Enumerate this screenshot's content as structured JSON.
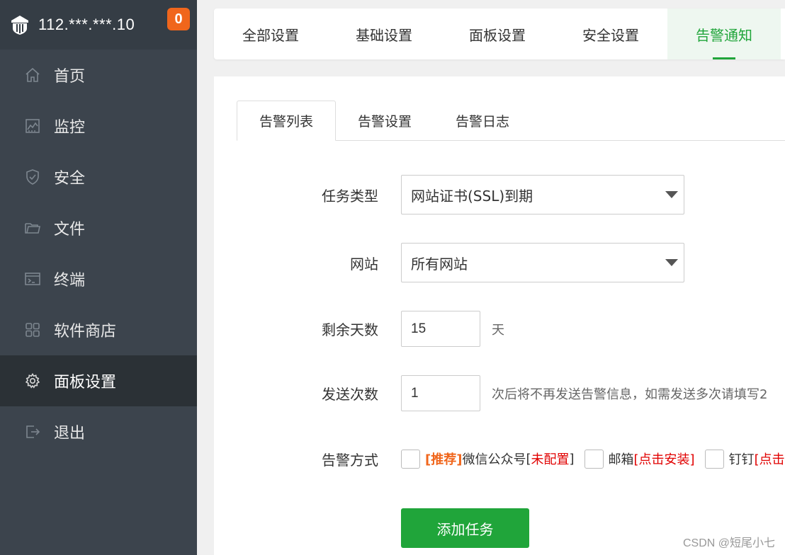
{
  "sidebar": {
    "server_name": "112.***.***.10",
    "badge_count": "0",
    "items": [
      {
        "label": "首页",
        "icon": "home-icon"
      },
      {
        "label": "监控",
        "icon": "monitor-icon"
      },
      {
        "label": "安全",
        "icon": "shield-icon"
      },
      {
        "label": "文件",
        "icon": "folder-icon"
      },
      {
        "label": "终端",
        "icon": "terminal-icon"
      },
      {
        "label": "软件商店",
        "icon": "apps-icon"
      },
      {
        "label": "面板设置",
        "icon": "gear-icon",
        "active": true
      },
      {
        "label": "退出",
        "icon": "logout-icon"
      }
    ]
  },
  "top_tabs": [
    {
      "label": "全部设置"
    },
    {
      "label": "基础设置"
    },
    {
      "label": "面板设置"
    },
    {
      "label": "安全设置"
    },
    {
      "label": "告警通知",
      "active": true
    }
  ],
  "sub_tabs": [
    {
      "label": "告警列表",
      "active": true
    },
    {
      "label": "告警设置"
    },
    {
      "label": "告警日志"
    }
  ],
  "form": {
    "task_type": {
      "label": "任务类型",
      "value": "网站证书(SSL)到期"
    },
    "site": {
      "label": "网站",
      "value": "所有网站"
    },
    "days_left": {
      "label": "剩余天数",
      "value": "15",
      "unit": "天"
    },
    "send_count": {
      "label": "发送次数",
      "value": "1",
      "hint": "次后将不再发送告警信息，如需发送多次请填写2"
    },
    "methods": {
      "label": "告警方式",
      "wechat": {
        "recommend": "[推荐]",
        "name": "微信公众号",
        "status_open": "[",
        "status": "未配置",
        "status_close": "]"
      },
      "email": {
        "name": "邮箱",
        "status": "[点击安装]"
      },
      "dingtalk": {
        "name": "钉钉",
        "status": "[点击"
      }
    },
    "submit_label": "添加任务"
  },
  "colors": {
    "accent": "#20a53a",
    "sidebar_bg": "#3c444d",
    "badge": "#f0661c",
    "warning_red": "#e10000"
  },
  "watermark": "CSDN @短尾小七"
}
